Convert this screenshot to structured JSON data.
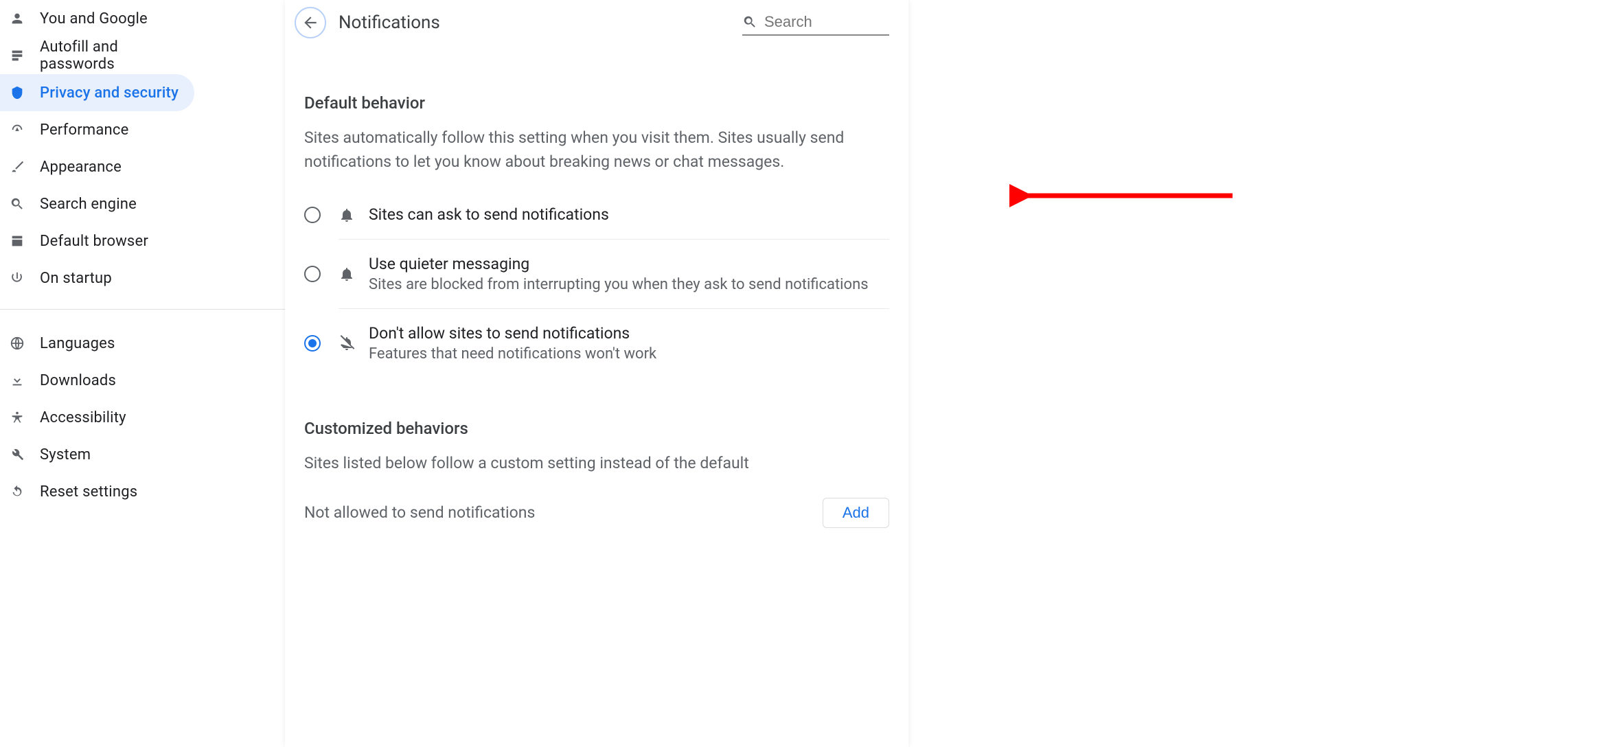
{
  "sidebar": {
    "group1": [
      {
        "label": "You and Google",
        "icon": "person"
      },
      {
        "label": "Autofill and passwords",
        "icon": "autofill"
      },
      {
        "label": "Privacy and security",
        "icon": "shield",
        "active": true
      },
      {
        "label": "Performance",
        "icon": "speed"
      },
      {
        "label": "Appearance",
        "icon": "brush"
      },
      {
        "label": "Search engine",
        "icon": "search"
      },
      {
        "label": "Default browser",
        "icon": "browser"
      },
      {
        "label": "On startup",
        "icon": "power"
      }
    ],
    "group2": [
      {
        "label": "Languages",
        "icon": "globe"
      },
      {
        "label": "Downloads",
        "icon": "download"
      },
      {
        "label": "Accessibility",
        "icon": "accessibility"
      },
      {
        "label": "System",
        "icon": "wrench"
      },
      {
        "label": "Reset settings",
        "icon": "reset"
      }
    ]
  },
  "header": {
    "title": "Notifications",
    "search_placeholder": "Search"
  },
  "default_behavior": {
    "title": "Default behavior",
    "desc": "Sites automatically follow this setting when you visit them. Sites usually send notifications to let you know about breaking news or chat messages.",
    "options": [
      {
        "label": "Sites can ask to send notifications",
        "sub": "",
        "icon": "bell",
        "checked": false
      },
      {
        "label": "Use quieter messaging",
        "sub": "Sites are blocked from interrupting you when they ask to send notifications",
        "icon": "bell",
        "checked": false
      },
      {
        "label": "Don't allow sites to send notifications",
        "sub": "Features that need notifications won't work",
        "icon": "bell-off",
        "checked": true
      }
    ]
  },
  "customized": {
    "title": "Customized behaviors",
    "desc": "Sites listed below follow a custom setting instead of the default",
    "not_allowed_label": "Not allowed to send notifications",
    "add_label": "Add"
  }
}
